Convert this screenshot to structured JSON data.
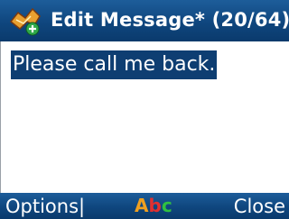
{
  "window": {
    "title": "Edit Message* (20/64)",
    "icon": "message-edit-icon"
  },
  "editor": {
    "text": "Please call me back."
  },
  "softkeys": {
    "left_label": "Options|",
    "center_mode": {
      "letters": [
        "A",
        "b",
        "c"
      ],
      "colors": [
        "#f0a020",
        "#e03030",
        "#30c040"
      ]
    },
    "right_label": "Close"
  },
  "colors": {
    "bar": "#0f467e",
    "selection": "#0e3e72"
  }
}
